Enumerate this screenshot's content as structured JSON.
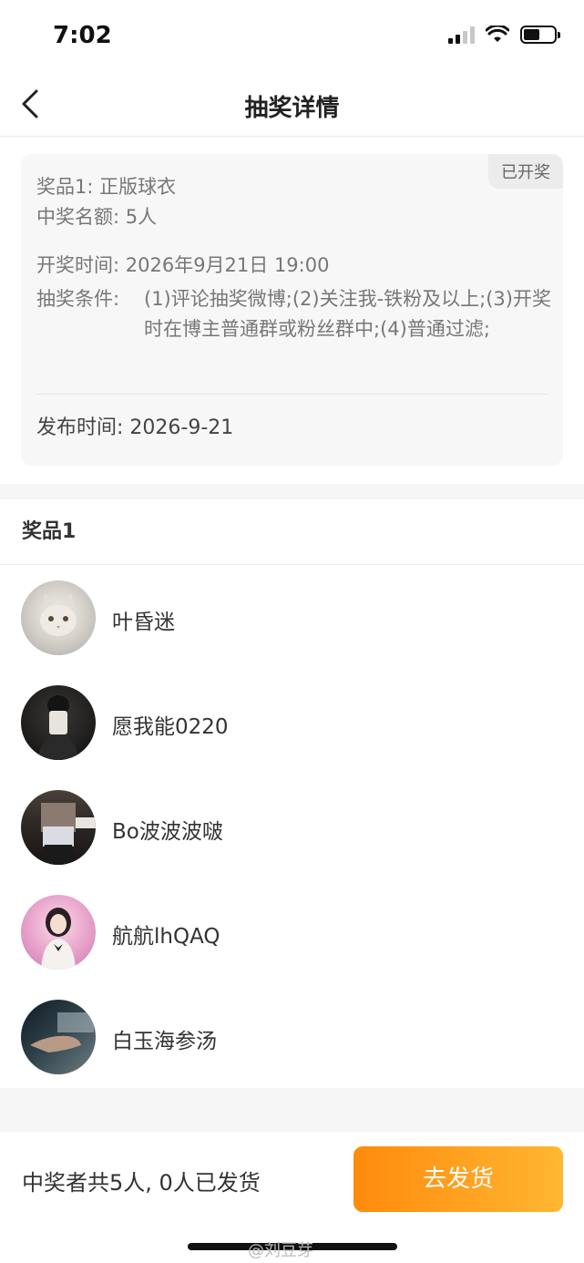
{
  "status_bar": {
    "time": "7:02"
  },
  "nav": {
    "title": "抽奖详情"
  },
  "info": {
    "badge": "已开奖",
    "prize": "奖品1:  正版球衣",
    "quota": "中奖名额:  5人",
    "draw_time": "开奖时间:  2026年9月21日 19:00",
    "condition_label": "抽奖条件:",
    "condition_text": "(1)评论抽奖微博;(2)关注我-铁粉及以上;(3)开奖时在博主普通群或粉丝群中;(4)普通过滤;",
    "publish_time": "发布时间: 2026-9-21"
  },
  "winners": {
    "title": "奖品1",
    "items": [
      {
        "name": "叶昏迷"
      },
      {
        "name": "愿我能0220"
      },
      {
        "name": "Bo波波波啵"
      },
      {
        "name": "航航lhQAQ"
      },
      {
        "name": "白玉海参汤"
      }
    ]
  },
  "footer": {
    "summary": "中奖者共5人, 0人已发货",
    "ship_button": "去发货",
    "watermark": "@刘豆芽"
  },
  "colors": {
    "accent_start": "#ff8a0c",
    "accent_end": "#ffb732"
  }
}
